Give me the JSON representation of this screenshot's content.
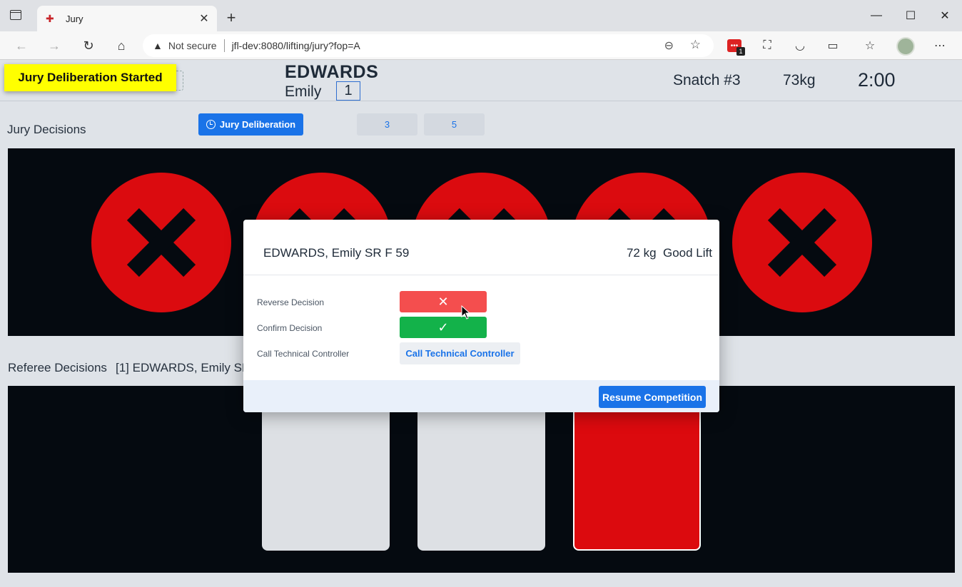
{
  "browser": {
    "tab_title": "Jury",
    "address_warning": "Not secure",
    "url": "jfl-dev:8080/lifting/jury?fop=A",
    "extension_badge": "1"
  },
  "header": {
    "notification": "Jury Deliberation Started",
    "athlete_last": "EDWARDS",
    "athlete_first": "Emily",
    "start_number": "1",
    "attempt": "Snatch #3",
    "weight": "73kg",
    "timer": "2:00"
  },
  "jury": {
    "title": "Jury Decisions",
    "deliberation_label": "Jury Deliberation",
    "jury_count_buttons": [
      "3",
      "5"
    ],
    "decisions": [
      "bad",
      "bad",
      "bad",
      "bad",
      "bad"
    ]
  },
  "referees": {
    "title": "Referee Decisions",
    "athlete": "[1] EDWARDS, Emily SR",
    "decisions": [
      "good",
      "good",
      "bad"
    ]
  },
  "dialog": {
    "athlete": "EDWARDS, Emily SR F 59",
    "result": "72 kg  Good Lift",
    "reverse_label": "Reverse Decision",
    "confirm_label": "Confirm Decision",
    "call_label": "Call Technical Controller",
    "call_button": "Call Technical Controller",
    "resume_button": "Resume Competition"
  },
  "colors": {
    "accent": "#1a73e8",
    "bad": "#db0b0f",
    "good_button": "#13b24a",
    "reverse_button": "#f44e4e",
    "notification": "#ffff00"
  }
}
